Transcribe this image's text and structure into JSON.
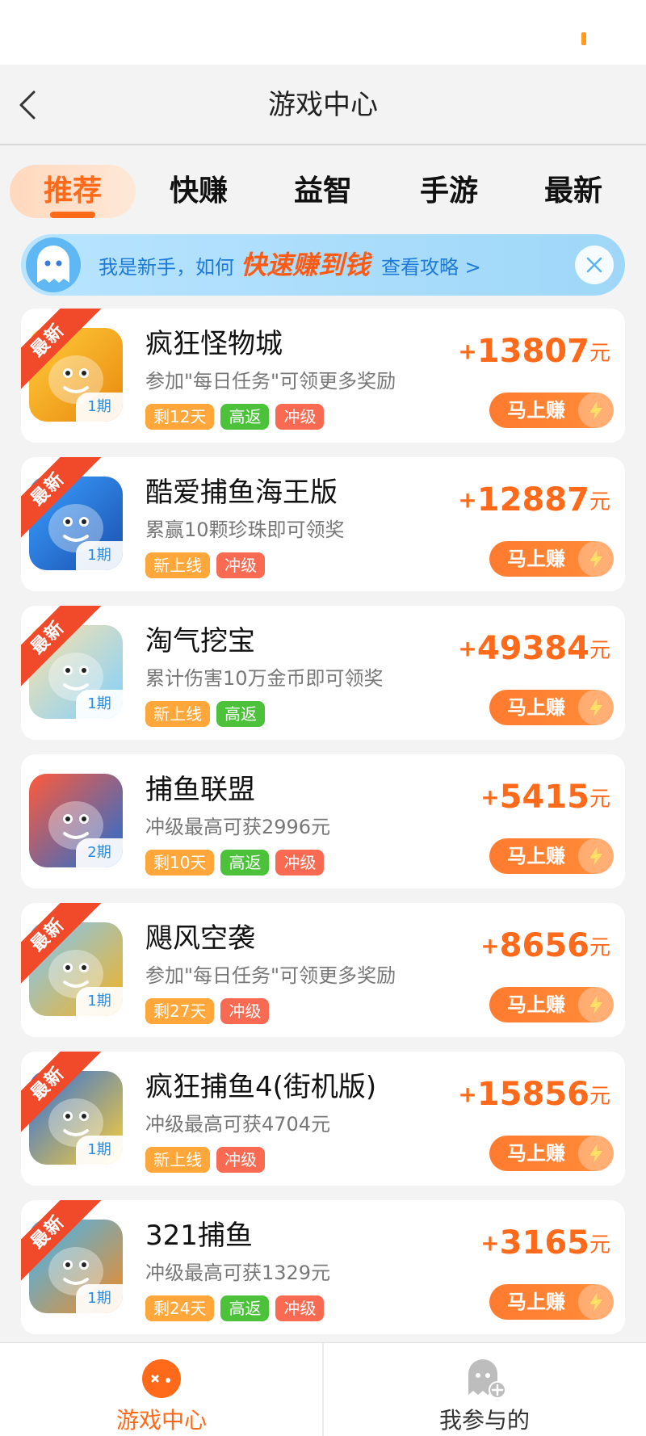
{
  "header": {
    "title": "游戏中心"
  },
  "tabs": [
    {
      "label": "推荐",
      "active": true
    },
    {
      "label": "快赚",
      "active": false
    },
    {
      "label": "益智",
      "active": false
    },
    {
      "label": "手游",
      "active": false
    },
    {
      "label": "最新",
      "active": false
    }
  ],
  "banner": {
    "text_before": "我是新手，如何",
    "highlight": "快速赚到钱",
    "link": "查看攻略 >"
  },
  "ribbon_label": "最新",
  "unit": "元",
  "earn_label": "马上赚",
  "games": [
    {
      "title": "疯狂怪物城",
      "desc": "参加\"每日任务\"可领更多奖励",
      "period": "1期",
      "reward": "13807",
      "is_new": true,
      "tags": [
        {
          "text": "剩12天",
          "color": "orange"
        },
        {
          "text": "高返",
          "color": "green"
        },
        {
          "text": "冲级",
          "color": "red"
        }
      ]
    },
    {
      "title": "酷爱捕鱼海王版",
      "desc": "累赢10颗珍珠即可领奖",
      "period": "1期",
      "reward": "12887",
      "is_new": true,
      "tags": [
        {
          "text": "新上线",
          "color": "orange"
        },
        {
          "text": "冲级",
          "color": "red"
        }
      ]
    },
    {
      "title": "淘气挖宝",
      "desc": "累计伤害10万金币即可领奖",
      "period": "1期",
      "reward": "49384",
      "is_new": true,
      "tags": [
        {
          "text": "新上线",
          "color": "orange"
        },
        {
          "text": "高返",
          "color": "green"
        }
      ]
    },
    {
      "title": "捕鱼联盟",
      "desc": "冲级最高可获2996元",
      "period": "2期",
      "reward": "5415",
      "is_new": false,
      "tags": [
        {
          "text": "剩10天",
          "color": "orange"
        },
        {
          "text": "高返",
          "color": "green"
        },
        {
          "text": "冲级",
          "color": "red"
        }
      ]
    },
    {
      "title": "飓风空袭",
      "desc": "参加\"每日任务\"可领更多奖励",
      "period": "1期",
      "reward": "8656",
      "is_new": true,
      "tags": [
        {
          "text": "剩27天",
          "color": "orange"
        },
        {
          "text": "冲级",
          "color": "red"
        }
      ]
    },
    {
      "title": "疯狂捕鱼4(街机版)",
      "desc": "冲级最高可获4704元",
      "period": "1期",
      "reward": "15856",
      "is_new": true,
      "tags": [
        {
          "text": "新上线",
          "color": "orange"
        },
        {
          "text": "冲级",
          "color": "red"
        }
      ]
    },
    {
      "title": "321捕鱼",
      "desc": "冲级最高可获1329元",
      "period": "1期",
      "reward": "3165",
      "is_new": true,
      "tags": [
        {
          "text": "剩24天",
          "color": "orange"
        },
        {
          "text": "高返",
          "color": "green"
        },
        {
          "text": "冲级",
          "color": "red"
        }
      ]
    }
  ],
  "bottom_nav": [
    {
      "label": "游戏中心",
      "icon": "game-controller-icon",
      "active": true
    },
    {
      "label": "我参与的",
      "icon": "ghost-plus-icon",
      "active": false
    }
  ],
  "colors": {
    "accent": "#ff6a1a",
    "tag_orange": "#ffa73a",
    "tag_green": "#4cc23b",
    "tag_red": "#f96a52",
    "banner_blue": "#1e7ad8"
  }
}
